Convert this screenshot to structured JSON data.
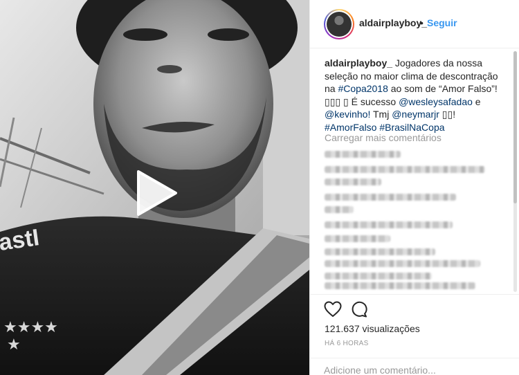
{
  "post": {
    "username": "aldairplayboy_",
    "follow_label": "Seguir",
    "separator": "•",
    "caption": {
      "username": "aldairplayboy_",
      "text_1": " Jogadores da nossa seleção no maior clima de descontração na ",
      "tag_copa": "#Copa2018",
      "text_2": " ao som de “Amor Falso”! ▯▯▯ ▯ É sucesso ",
      "mention_1": "@wesleysafadao",
      "text_3": " e ",
      "mention_2": "@kevinho!",
      "text_4": " Tmj ",
      "mention_3": "@neymarjr",
      "text_5": " ▯▯! ",
      "tag_amor": "#AmorFalso",
      "text_6": " ",
      "tag_brasil": "#BrasilNaCopa"
    },
    "load_more_label": "Carregar mais comentários",
    "views": "121.637 visualizações",
    "timestamp": "HÁ 6 HORAS",
    "comment_placeholder": "Adicione um comentário..."
  },
  "icons": {
    "play": "play-icon",
    "like": "heart-icon",
    "comment": "comment-bubble-icon"
  },
  "colors": {
    "link": "#003569",
    "follow": "#3897f0",
    "muted": "#999999",
    "border": "#efefef"
  }
}
